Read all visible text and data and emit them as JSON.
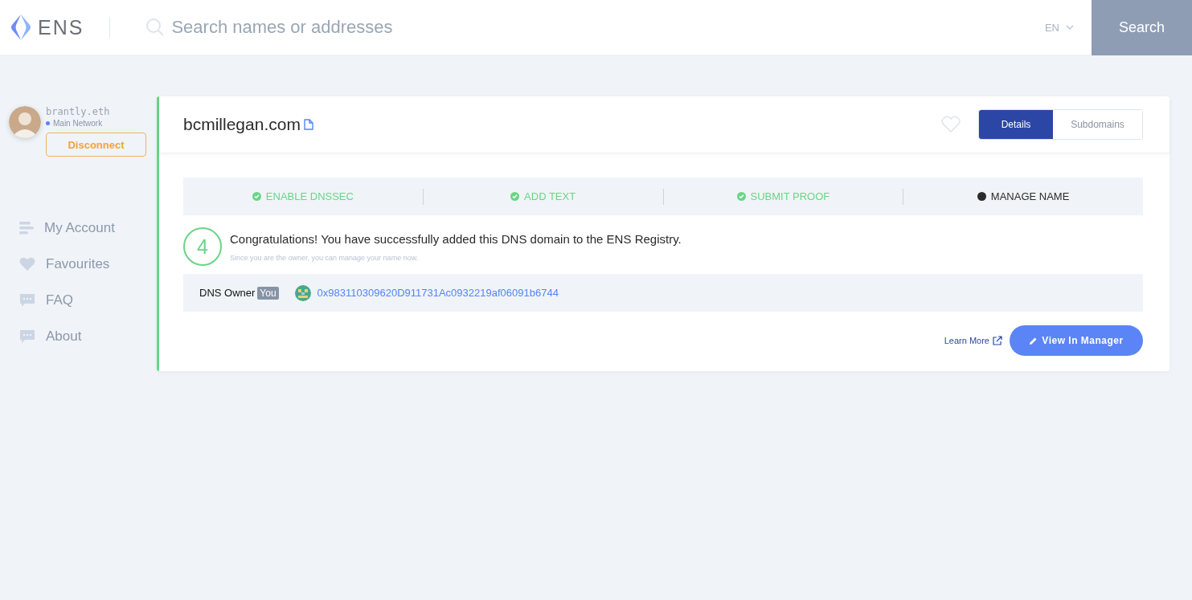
{
  "header": {
    "logo": "ENS",
    "search": {
      "placeholder": "Search names or addresses"
    },
    "language": "EN",
    "search_button": "Search"
  },
  "account": {
    "name": "brantly.eth",
    "network": "Main Network",
    "disconnect": "Disconnect"
  },
  "nav": [
    {
      "label": "My Account",
      "kind": "account"
    },
    {
      "label": "Favourites",
      "kind": "heart"
    },
    {
      "label": "FAQ",
      "kind": "chat"
    },
    {
      "label": "About",
      "kind": "chat"
    }
  ],
  "domain": {
    "name": "bcmillegan.com",
    "favourite": false,
    "tabs": [
      {
        "label": "Details",
        "selected": true
      },
      {
        "label": "Subdomains",
        "selected": false
      }
    ],
    "steps": [
      {
        "label": "ENABLE DNSSEC",
        "done": true
      },
      {
        "label": "ADD TEXT",
        "done": true
      },
      {
        "label": "SUBMIT PROOF",
        "done": true
      },
      {
        "label": "MANAGE NAME",
        "done": false
      }
    ],
    "step_number": "4",
    "message": "Congratulations! You have successfully added this DNS domain to the ENS Registry.",
    "note": "Since you are the owner, you can manage your name now.",
    "owner": {
      "label": "DNS Owner",
      "badge": "You",
      "address": "0x983110309620D911731Ac0932219af06091b6744"
    },
    "learn_more": "Learn More",
    "manager_button": "View In Manager"
  }
}
